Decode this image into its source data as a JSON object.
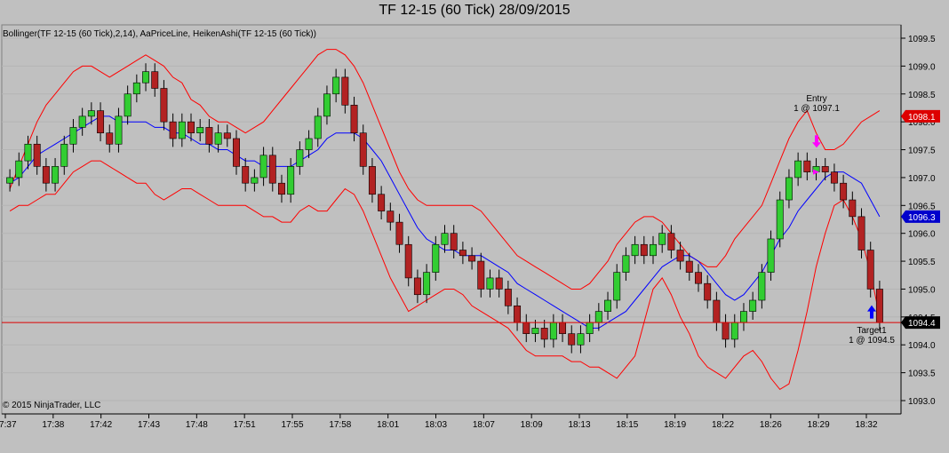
{
  "window": {
    "title": "TF 12-15 (60 Tick)  28/09/2015",
    "indicators_label": "Bollinger(TF 12-15 (60 Tick),2,14), AaPriceLine, HeikenAshi(TF 12-15 (60 Tick))",
    "copyright": "© 2015 NinjaTrader, LLC"
  },
  "colors": {
    "background": "#c0c0c0",
    "up_candle": "#32cd32",
    "down_candle": "#b22222",
    "bollinger_band": "#ff0000",
    "bollinger_mid": "#0000ff",
    "price_line": "#dd0000",
    "entry_arrow": "#ff00ff",
    "target_arrow": "#0000ff"
  },
  "annotations": {
    "entry_label": "Entry",
    "entry_detail": "1 @ 1097.1",
    "target_label": "Target1",
    "target_detail": "1 @ 1094.5"
  },
  "chart_data": {
    "type": "candlestick",
    "ylim": [
      1092.9,
      1099.6
    ],
    "y_ticks": [
      1093.0,
      1093.5,
      1094.0,
      1094.5,
      1095.0,
      1095.5,
      1096.0,
      1096.5,
      1097.0,
      1097.5,
      1098.0,
      1098.5,
      1099.0,
      1099.5
    ],
    "x_tick_labels": [
      "17:37",
      "17:38",
      "17:42",
      "17:43",
      "17:48",
      "17:51",
      "17:55",
      "17:58",
      "18:01",
      "18:03",
      "18:07",
      "18:09",
      "18:13",
      "18:15",
      "18:19",
      "18:22",
      "18:26",
      "18:29",
      "18:32"
    ],
    "price_labels": [
      {
        "value": 1098.1,
        "text": "1098.1",
        "color": "#dd0000"
      },
      {
        "value": 1096.3,
        "text": "1096.3",
        "color": "#0000cc"
      },
      {
        "value": 1094.4,
        "text": "1094.4",
        "color": "#000000"
      }
    ],
    "price_line": 1094.4,
    "closes": [
      1097.0,
      1097.3,
      1097.6,
      1097.2,
      1096.9,
      1097.2,
      1097.6,
      1097.9,
      1098.1,
      1098.2,
      1097.8,
      1097.6,
      1098.1,
      1098.5,
      1098.7,
      1098.9,
      1098.6,
      1098.0,
      1097.7,
      1098.0,
      1097.8,
      1097.9,
      1097.6,
      1097.8,
      1097.7,
      1097.2,
      1096.9,
      1097.0,
      1097.4,
      1096.9,
      1096.7,
      1097.2,
      1097.5,
      1097.7,
      1098.1,
      1098.5,
      1098.8,
      1098.3,
      1097.8,
      1097.2,
      1096.7,
      1096.4,
      1096.2,
      1095.8,
      1095.2,
      1094.9,
      1095.3,
      1095.8,
      1096.0,
      1095.7,
      1095.6,
      1095.5,
      1095.0,
      1095.2,
      1095.0,
      1094.7,
      1094.4,
      1094.2,
      1094.3,
      1094.1,
      1094.4,
      1094.2,
      1094.0,
      1094.2,
      1094.4,
      1094.6,
      1094.8,
      1095.3,
      1095.6,
      1095.8,
      1095.6,
      1095.8,
      1096.0,
      1095.7,
      1095.5,
      1095.3,
      1095.1,
      1094.8,
      1094.4,
      1094.1,
      1094.4,
      1094.6,
      1094.8,
      1095.3,
      1095.9,
      1096.6,
      1097.0,
      1097.3,
      1097.1,
      1097.2,
      1097.1,
      1096.9,
      1096.6,
      1096.3,
      1095.7,
      1095.0,
      1094.4
    ],
    "bollinger_upper": [
      1096.8,
      1097.2,
      1097.6,
      1098.0,
      1098.3,
      1098.5,
      1098.7,
      1098.9,
      1099.0,
      1099.0,
      1098.9,
      1098.8,
      1098.9,
      1099.0,
      1099.1,
      1099.2,
      1099.1,
      1099.0,
      1098.8,
      1098.7,
      1098.4,
      1098.3,
      1098.1,
      1098.0,
      1098.0,
      1097.9,
      1097.8,
      1097.9,
      1098.0,
      1098.2,
      1098.4,
      1098.6,
      1098.8,
      1099.0,
      1099.2,
      1099.3,
      1099.3,
      1099.2,
      1099.0,
      1098.7,
      1098.3,
      1097.9,
      1097.5,
      1097.1,
      1096.8,
      1096.6,
      1096.5,
      1096.5,
      1096.5,
      1096.5,
      1096.5,
      1096.5,
      1096.4,
      1096.2,
      1096.0,
      1095.8,
      1095.6,
      1095.5,
      1095.4,
      1095.3,
      1095.2,
      1095.1,
      1095.0,
      1095.0,
      1095.1,
      1095.3,
      1095.5,
      1095.8,
      1096.0,
      1096.2,
      1096.3,
      1096.3,
      1096.2,
      1096.0,
      1095.8,
      1095.6,
      1095.5,
      1095.4,
      1095.4,
      1095.6,
      1095.9,
      1096.1,
      1096.3,
      1096.5,
      1096.9,
      1097.3,
      1097.7,
      1098.0,
      1098.2,
      1097.8,
      1097.5,
      1097.5,
      1097.6,
      1097.8,
      1098.0,
      1098.1,
      1098.2
    ],
    "bollinger_mid": [
      1096.9,
      1097.0,
      1097.2,
      1097.4,
      1097.5,
      1097.6,
      1097.7,
      1097.8,
      1097.9,
      1098.0,
      1098.1,
      1098.1,
      1098.0,
      1098.0,
      1098.0,
      1098.0,
      1097.9,
      1097.9,
      1097.8,
      1097.8,
      1097.7,
      1097.6,
      1097.6,
      1097.5,
      1097.5,
      1097.4,
      1097.3,
      1097.3,
      1097.2,
      1097.2,
      1097.2,
      1097.2,
      1097.3,
      1097.4,
      1097.5,
      1097.7,
      1097.8,
      1097.8,
      1097.8,
      1097.7,
      1097.5,
      1097.3,
      1097.0,
      1096.7,
      1096.4,
      1096.1,
      1095.9,
      1095.8,
      1095.7,
      1095.7,
      1095.6,
      1095.6,
      1095.6,
      1095.5,
      1095.4,
      1095.3,
      1095.1,
      1095.0,
      1094.9,
      1094.8,
      1094.7,
      1094.6,
      1094.5,
      1094.4,
      1094.3,
      1094.3,
      1094.4,
      1094.5,
      1094.6,
      1094.8,
      1095.0,
      1095.2,
      1095.4,
      1095.5,
      1095.6,
      1095.6,
      1095.5,
      1095.3,
      1095.1,
      1094.9,
      1094.8,
      1094.9,
      1095.1,
      1095.3,
      1095.6,
      1095.9,
      1096.1,
      1096.4,
      1096.6,
      1096.8,
      1097.0,
      1097.1,
      1097.1,
      1097.0,
      1096.9,
      1096.6,
      1096.3
    ],
    "bollinger_lower": [
      1096.4,
      1096.5,
      1096.5,
      1096.6,
      1096.7,
      1096.7,
      1096.9,
      1097.1,
      1097.2,
      1097.3,
      1097.3,
      1097.2,
      1097.1,
      1097.0,
      1096.9,
      1096.9,
      1096.7,
      1096.6,
      1096.7,
      1096.8,
      1096.8,
      1096.7,
      1096.6,
      1096.5,
      1096.5,
      1096.5,
      1096.5,
      1096.4,
      1096.3,
      1096.3,
      1096.2,
      1096.2,
      1096.4,
      1096.5,
      1096.4,
      1096.4,
      1096.6,
      1096.8,
      1096.7,
      1096.4,
      1096.0,
      1095.6,
      1095.2,
      1094.9,
      1094.6,
      1094.7,
      1094.8,
      1094.9,
      1095.0,
      1095.0,
      1094.9,
      1094.7,
      1094.6,
      1094.5,
      1094.4,
      1094.3,
      1094.1,
      1093.9,
      1093.8,
      1093.8,
      1093.8,
      1093.8,
      1093.7,
      1093.7,
      1093.6,
      1093.6,
      1093.5,
      1093.4,
      1093.6,
      1093.8,
      1094.4,
      1095.0,
      1095.2,
      1094.9,
      1094.5,
      1094.2,
      1093.8,
      1093.6,
      1093.5,
      1093.4,
      1093.6,
      1093.8,
      1093.9,
      1093.7,
      1093.4,
      1093.2,
      1093.3,
      1093.9,
      1094.6,
      1095.4,
      1096.0,
      1096.5,
      1096.6,
      1096.3,
      1095.9,
      1095.3,
      1094.5
    ]
  }
}
